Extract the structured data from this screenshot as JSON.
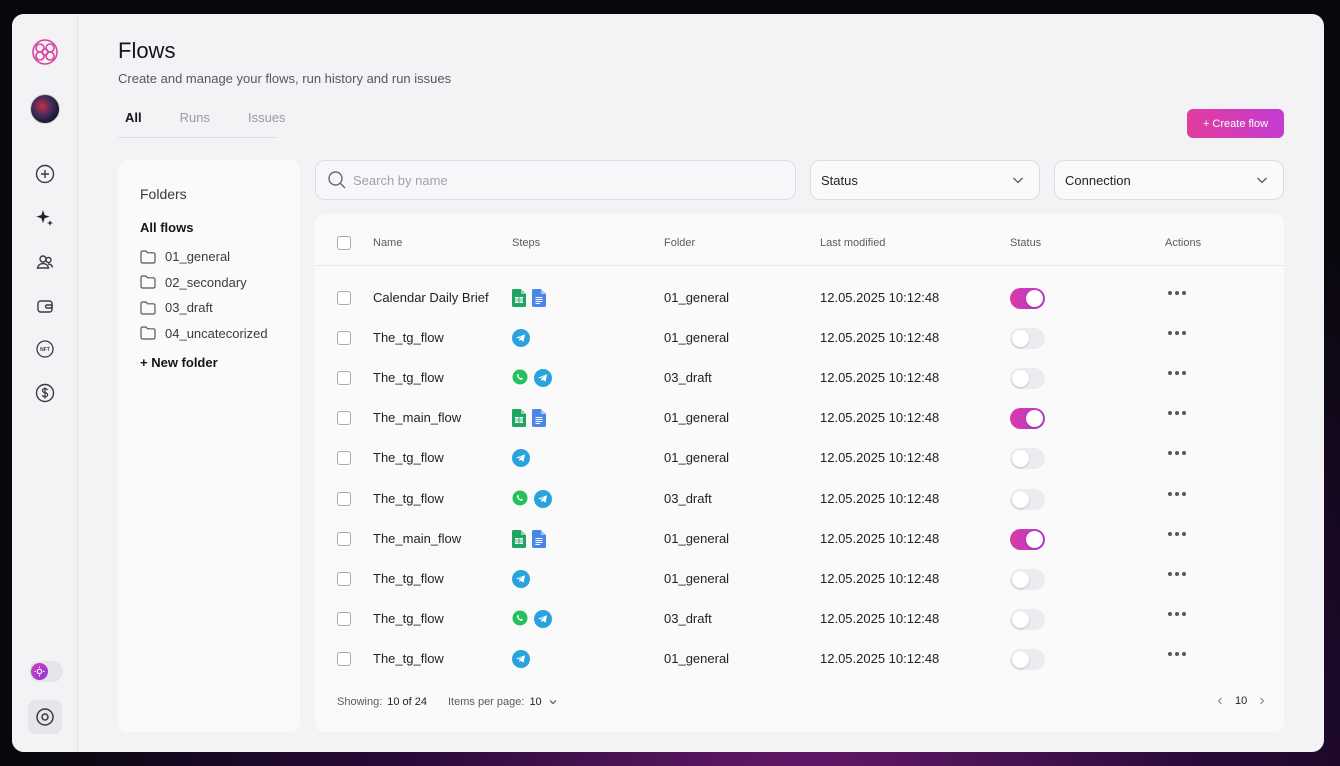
{
  "page": {
    "title": "Flows",
    "subtitle": "Create and manage your flows, run history and run issues",
    "create_button": "+ Create flow"
  },
  "tabs": [
    {
      "label": "All",
      "active": true
    },
    {
      "label": "Runs",
      "active": false
    },
    {
      "label": "Issues",
      "active": false
    }
  ],
  "rail": {
    "icons": [
      "brain-logo-icon",
      "add-circle-icon",
      "sparkles-icon",
      "users-icon",
      "wallet-icon",
      "nft-icon",
      "dollar-icon",
      "theme-toggle-icon",
      "settings-circle-icon"
    ]
  },
  "folders": {
    "heading": "Folders",
    "all_label": "All flows",
    "items": [
      "01_general",
      "02_secondary",
      "03_draft",
      "04_uncatecorized"
    ],
    "new_folder": "+ New folder"
  },
  "filters": {
    "search_placeholder": "Search by name",
    "status_label": "Status",
    "connection_label": "Connection"
  },
  "table": {
    "columns": [
      "Name",
      "Steps",
      "Folder",
      "Last modified",
      "Status",
      "Actions"
    ],
    "rows": [
      {
        "name": "Calendar Daily Brief",
        "steps": [
          "google-sheets-icon",
          "google-docs-icon"
        ],
        "folder": "01_general",
        "modified": "12.05.2025 10:12:48",
        "enabled": true
      },
      {
        "name": "The_tg_flow",
        "steps": [
          "telegram-icon"
        ],
        "folder": "01_general",
        "modified": "12.05.2025 10:12:48",
        "enabled": false
      },
      {
        "name": "The_tg_flow",
        "steps": [
          "whatsapp-icon",
          "telegram-icon"
        ],
        "folder": "03_draft",
        "modified": "12.05.2025 10:12:48",
        "enabled": false
      },
      {
        "name": "The_main_flow",
        "steps": [
          "google-sheets-icon",
          "google-docs-icon"
        ],
        "folder": "01_general",
        "modified": "12.05.2025 10:12:48",
        "enabled": true
      },
      {
        "name": "The_tg_flow",
        "steps": [
          "telegram-icon"
        ],
        "folder": "01_general",
        "modified": "12.05.2025 10:12:48",
        "enabled": false
      },
      {
        "name": "The_tg_flow",
        "steps": [
          "whatsapp-icon",
          "telegram-icon"
        ],
        "folder": "03_draft",
        "modified": "12.05.2025 10:12:48",
        "enabled": false
      },
      {
        "name": "The_main_flow",
        "steps": [
          "google-sheets-icon",
          "google-docs-icon"
        ],
        "folder": "01_general",
        "modified": "12.05.2025 10:12:48",
        "enabled": true
      },
      {
        "name": "The_tg_flow",
        "steps": [
          "telegram-icon"
        ],
        "folder": "01_general",
        "modified": "12.05.2025 10:12:48",
        "enabled": false
      },
      {
        "name": "The_tg_flow",
        "steps": [
          "whatsapp-icon",
          "telegram-icon"
        ],
        "folder": "03_draft",
        "modified": "12.05.2025 10:12:48",
        "enabled": false
      },
      {
        "name": "The_tg_flow",
        "steps": [
          "telegram-icon"
        ],
        "folder": "01_general",
        "modified": "12.05.2025 10:12:48",
        "enabled": false
      }
    ]
  },
  "pagination": {
    "showing_label": "Showing:",
    "showing_value": "10 of 24",
    "per_page_label": "Items per page:",
    "per_page_value": "10",
    "current_page": "10"
  },
  "colors": {
    "accent": "#d93aa8",
    "accent_end": "#b83ad0",
    "telegram": "#2aa3dd",
    "whatsapp": "#25c15a",
    "sheets": "#1fa463",
    "docs": "#4a86e8"
  }
}
